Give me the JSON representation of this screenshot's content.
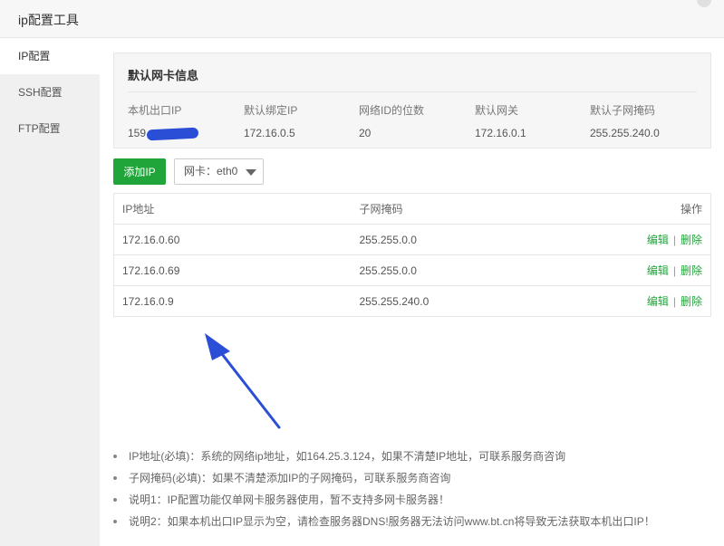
{
  "window": {
    "title": "ip配置工具"
  },
  "sidebar": {
    "items": [
      {
        "label": "IP配置",
        "active": true
      },
      {
        "label": "SSH配置",
        "active": false
      },
      {
        "label": "FTP配置",
        "active": false
      }
    ]
  },
  "nic_info": {
    "title": "默认网卡信息",
    "fields": [
      {
        "label": "本机出口IP",
        "value": "159"
      },
      {
        "label": "默认绑定IP",
        "value": "172.16.0.5"
      },
      {
        "label": "网络ID的位数",
        "value": "20"
      },
      {
        "label": "默认网关",
        "value": "172.16.0.1"
      },
      {
        "label": "默认子网掩码",
        "value": "255.255.240.0"
      }
    ]
  },
  "toolbar": {
    "add_label": "添加IP",
    "nic_select_value": "网卡：eth0"
  },
  "table": {
    "headers": {
      "ip": "IP地址",
      "mask": "子网掩码",
      "ops": "操作"
    },
    "rows": [
      {
        "ip": "172.16.0.60",
        "mask": "255.255.0.0",
        "edit": "编辑",
        "sep": "|",
        "delete": "删除"
      },
      {
        "ip": "172.16.0.69",
        "mask": "255.255.0.0",
        "edit": "编辑",
        "sep": "|",
        "delete": "删除"
      },
      {
        "ip": "172.16.0.9",
        "mask": "255.255.240.0",
        "edit": "编辑",
        "sep": "|",
        "delete": "删除"
      }
    ]
  },
  "notes": [
    "IP地址(必填)：系统的网络ip地址，如164.25.3.124，如果不清楚IP地址，可联系服务商咨询",
    "子网掩码(必填)：如果不清楚添加IP的子网掩码，可联系服务商咨询",
    "说明1：IP配置功能仅单网卡服务器使用，暂不支持多网卡服务器！",
    "说明2：如果本机出口IP显示为空，请检查服务器DNS!服务器无法访问www.bt.cn将导致无法获取本机出口IP！"
  ],
  "colors": {
    "accent": "#20a53a",
    "annotation": "#2a4ed6"
  }
}
